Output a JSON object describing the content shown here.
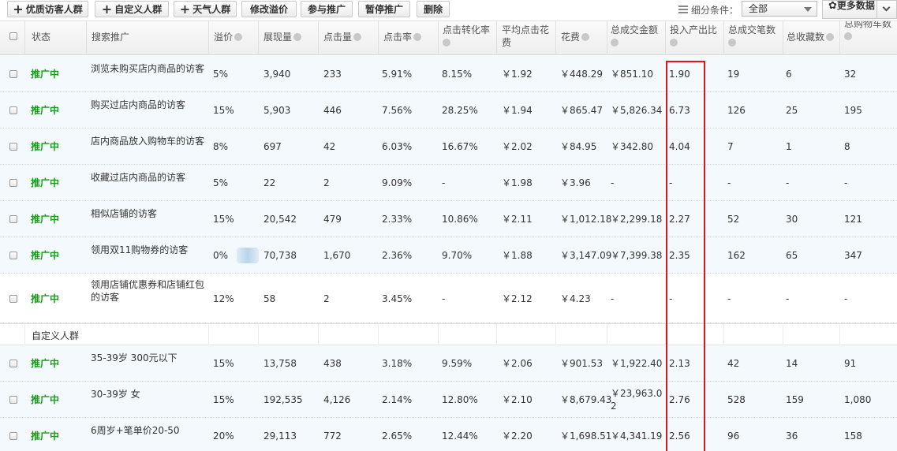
{
  "toolbar": {
    "buttons": [
      {
        "label": "优质访客人群",
        "plus": true
      },
      {
        "label": "自定义人群",
        "plus": true
      },
      {
        "label": "天气人群",
        "plus": true
      },
      {
        "label": "修改溢价",
        "plus": false
      },
      {
        "label": "参与推广",
        "plus": false
      },
      {
        "label": "暂停推广",
        "plus": false
      },
      {
        "label": "删除",
        "plus": false
      }
    ],
    "filter_label": "细分条件：",
    "filter_value": "全部",
    "more_label": "更多数据"
  },
  "columns": [
    "状态",
    "搜索推广",
    "溢价",
    "展现量",
    "点击量",
    "点击率",
    "点击转化率",
    "平均点击花费",
    "花费",
    "总成交金额",
    "投入产出比",
    "总成交笔数",
    "总收藏数",
    "总购物车数"
  ],
  "rows_group1": [
    {
      "status": "推广中",
      "name": "浏览未购买店内商品的访客",
      "premium": "5%",
      "impressions": "3,940",
      "clicks": "233",
      "ctr": "5.91%",
      "cvr": "8.15%",
      "cpc": "￥1.92",
      "cost": "￥448.29",
      "gmv": "￥851.10",
      "roi": "1.90",
      "orders": "19",
      "favs": "6",
      "carts": "32"
    },
    {
      "status": "推广中",
      "name": "购买过店内商品的访客",
      "premium": "15%",
      "impressions": "5,903",
      "clicks": "446",
      "ctr": "7.56%",
      "cvr": "28.25%",
      "cpc": "￥1.94",
      "cost": "￥865.47",
      "gmv": "￥5,826.34",
      "roi": "6.73",
      "orders": "126",
      "favs": "25",
      "carts": "195"
    },
    {
      "status": "推广中",
      "name": "店内商品放入购物车的访客",
      "premium": "8%",
      "impressions": "697",
      "clicks": "42",
      "ctr": "6.03%",
      "cvr": "16.67%",
      "cpc": "￥2.02",
      "cost": "￥84.95",
      "gmv": "￥342.80",
      "roi": "4.04",
      "orders": "7",
      "favs": "1",
      "carts": "8"
    },
    {
      "status": "推广中",
      "name": "收藏过店内商品的访客",
      "premium": "5%",
      "impressions": "22",
      "clicks": "2",
      "ctr": "9.09%",
      "cvr": "-",
      "cpc": "￥1.98",
      "cost": "￥3.96",
      "gmv": "-",
      "roi": "-",
      "orders": "-",
      "favs": "-",
      "carts": "-"
    },
    {
      "status": "推广中",
      "name": "相似店铺的访客",
      "premium": "15%",
      "impressions": "20,542",
      "clicks": "479",
      "ctr": "2.33%",
      "cvr": "10.86%",
      "cpc": "￥2.11",
      "cost": "￥1,012.18",
      "gmv": "￥2,299.18",
      "roi": "2.27",
      "orders": "52",
      "favs": "30",
      "carts": "121"
    },
    {
      "status": "推广中",
      "name": "领用双11购物券的访客",
      "premium": "0%",
      "impressions": "70,738",
      "clicks": "1,670",
      "ctr": "2.36%",
      "cvr": "9.70%",
      "cpc": "￥1.88",
      "cost": "￥3,147.09",
      "gmv": "￥7,399.38",
      "roi": "2.35",
      "orders": "162",
      "favs": "65",
      "carts": "347"
    },
    {
      "status": "推广中",
      "name": "领用店铺优惠券和店铺红包的访客",
      "premium": "12%",
      "impressions": "58",
      "clicks": "2",
      "ctr": "3.45%",
      "cvr": "-",
      "cpc": "￥2.12",
      "cost": "￥4.23",
      "gmv": "-",
      "roi": "-",
      "orders": "-",
      "favs": "-",
      "carts": "-"
    }
  ],
  "group2_label": "自定义人群",
  "rows_group2": [
    {
      "status": "推广中",
      "name": "35-39岁 300元以下",
      "premium": "15%",
      "impressions": "13,758",
      "clicks": "438",
      "ctr": "3.18%",
      "cvr": "9.59%",
      "cpc": "￥2.06",
      "cost": "￥901.53",
      "gmv": "￥1,922.40",
      "roi": "2.13",
      "orders": "42",
      "favs": "14",
      "carts": "91"
    },
    {
      "status": "推广中",
      "name": "30-39岁 女",
      "premium": "15%",
      "impressions": "192,535",
      "clicks": "4,126",
      "ctr": "2.14%",
      "cvr": "12.80%",
      "cpc": "￥2.10",
      "cost": "￥8,679.43",
      "gmv": "￥23,963.02",
      "roi": "2.76",
      "orders": "528",
      "favs": "159",
      "carts": "1,080"
    },
    {
      "status": "推广中",
      "name": "6周岁+笔单价20-50",
      "premium": "20%",
      "impressions": "29,113",
      "clicks": "772",
      "ctr": "2.65%",
      "cvr": "12.44%",
      "cpc": "￥2.20",
      "cost": "￥1,698.51",
      "gmv": "￥4,341.19",
      "roi": "2.56",
      "orders": "96",
      "favs": "36",
      "carts": "158"
    }
  ],
  "colors": {
    "status_green": "#1a9a1a",
    "highlight_red": "#e0141e",
    "row_blue": "#f4f9fd"
  }
}
